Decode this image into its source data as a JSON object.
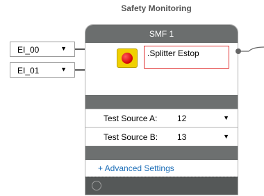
{
  "header": {
    "title": "Safety Monitoring"
  },
  "inputs": [
    {
      "value": "EI_00",
      "arrow": "▼"
    },
    {
      "value": "EI_01",
      "arrow": "▼"
    }
  ],
  "block": {
    "title": "SMF 1",
    "tag_name": ".Splitter Estop",
    "icon": "emergency-stop-icon",
    "params": [
      {
        "label": "Test Source A:",
        "value": "12",
        "arrow": "▼"
      },
      {
        "label": "Test Source B:",
        "value": "13",
        "arrow": "▼"
      }
    ],
    "advanced_link": "+ Advanced Settings"
  },
  "colors": {
    "header_bar": "#6b6e6e",
    "tag_border": "#e03030",
    "link": "#1e6fb8",
    "estop_yellow": "#f0d000",
    "estop_red": "#d40000"
  }
}
